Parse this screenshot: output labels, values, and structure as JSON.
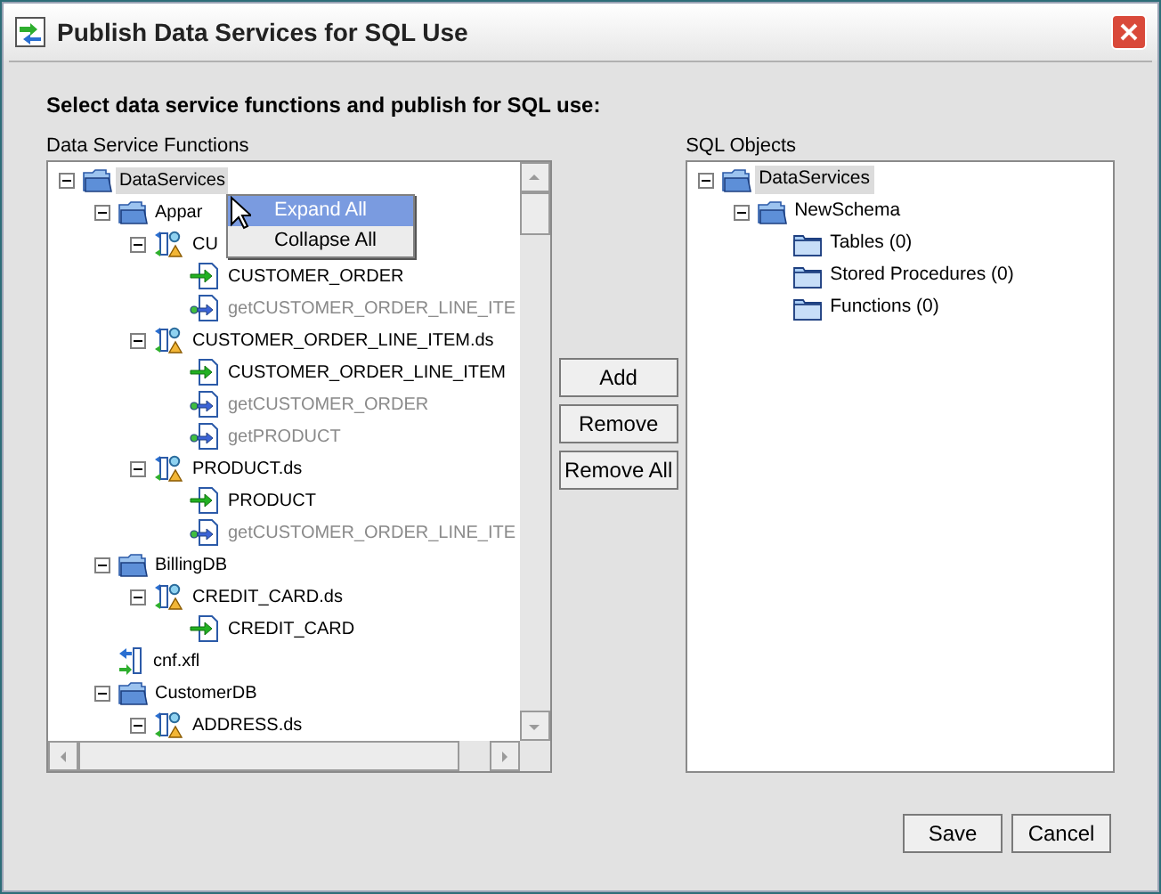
{
  "window": {
    "title": "Publish Data Services for SQL Use"
  },
  "instruction": "Select data service functions and publish for SQL use:",
  "functions_panel": {
    "label": "Data Service Functions",
    "tree": [
      {
        "kind": "schema",
        "label": "DataServices",
        "expanded": true,
        "selected": true,
        "children": [
          {
            "kind": "schema",
            "label": "Appar",
            "expanded": true,
            "selected": false,
            "children": [
              {
                "kind": "dataservice",
                "label": "CU",
                "expanded": true,
                "selected": false,
                "children": [
                  {
                    "kind": "function",
                    "label": "CUSTOMER_ORDER",
                    "disabled": false,
                    "selected": false
                  },
                  {
                    "kind": "procedure",
                    "label": "getCUSTOMER_ORDER_LINE_ITE",
                    "disabled": true,
                    "selected": false
                  }
                ]
              },
              {
                "kind": "dataservice",
                "label": "CUSTOMER_ORDER_LINE_ITEM.ds",
                "expanded": true,
                "selected": false,
                "children": [
                  {
                    "kind": "function",
                    "label": "CUSTOMER_ORDER_LINE_ITEM",
                    "disabled": false,
                    "selected": false
                  },
                  {
                    "kind": "procedure",
                    "label": "getCUSTOMER_ORDER",
                    "disabled": true,
                    "selected": false
                  },
                  {
                    "kind": "procedure",
                    "label": "getPRODUCT",
                    "disabled": true,
                    "selected": false
                  }
                ]
              },
              {
                "kind": "dataservice",
                "label": "PRODUCT.ds",
                "expanded": true,
                "selected": false,
                "children": [
                  {
                    "kind": "function",
                    "label": "PRODUCT",
                    "disabled": false,
                    "selected": false
                  },
                  {
                    "kind": "procedure",
                    "label": "getCUSTOMER_ORDER_LINE_ITE",
                    "disabled": true,
                    "selected": false
                  }
                ]
              }
            ]
          },
          {
            "kind": "schema",
            "label": "BillingDB",
            "expanded": true,
            "selected": false,
            "children": [
              {
                "kind": "dataservice",
                "label": "CREDIT_CARD.ds",
                "expanded": true,
                "selected": false,
                "children": [
                  {
                    "kind": "function",
                    "label": "CREDIT_CARD",
                    "disabled": false,
                    "selected": false
                  }
                ]
              }
            ]
          },
          {
            "kind": "file",
            "label": "cnf.xfl",
            "selected": false
          },
          {
            "kind": "schema",
            "label": "CustomerDB",
            "expanded": true,
            "selected": false,
            "children": [
              {
                "kind": "dataservice",
                "label": "ADDRESS.ds",
                "expanded": true,
                "selected": false
              }
            ]
          }
        ]
      }
    ]
  },
  "context_menu": [
    {
      "label": "Expand All",
      "selected": true
    },
    {
      "label": "Collapse All",
      "selected": false
    }
  ],
  "buttons": [
    "Add",
    "Remove",
    "Remove All"
  ],
  "sql_panel": {
    "label": "SQL Objects",
    "tree": [
      {
        "kind": "schema",
        "label": "DataServices",
        "expanded": true,
        "selected": true,
        "children": [
          {
            "kind": "schema",
            "label": "NewSchema",
            "expanded": true,
            "selected": false,
            "children": [
              {
                "kind": "folder",
                "label": "Tables (0)",
                "selected": false
              },
              {
                "kind": "folder",
                "label": "Stored Procedures (0)",
                "selected": false
              },
              {
                "kind": "folder",
                "label": "Functions (0)",
                "selected": false
              }
            ]
          }
        ]
      }
    ]
  },
  "footer_buttons": [
    "Save",
    "Cancel"
  ]
}
